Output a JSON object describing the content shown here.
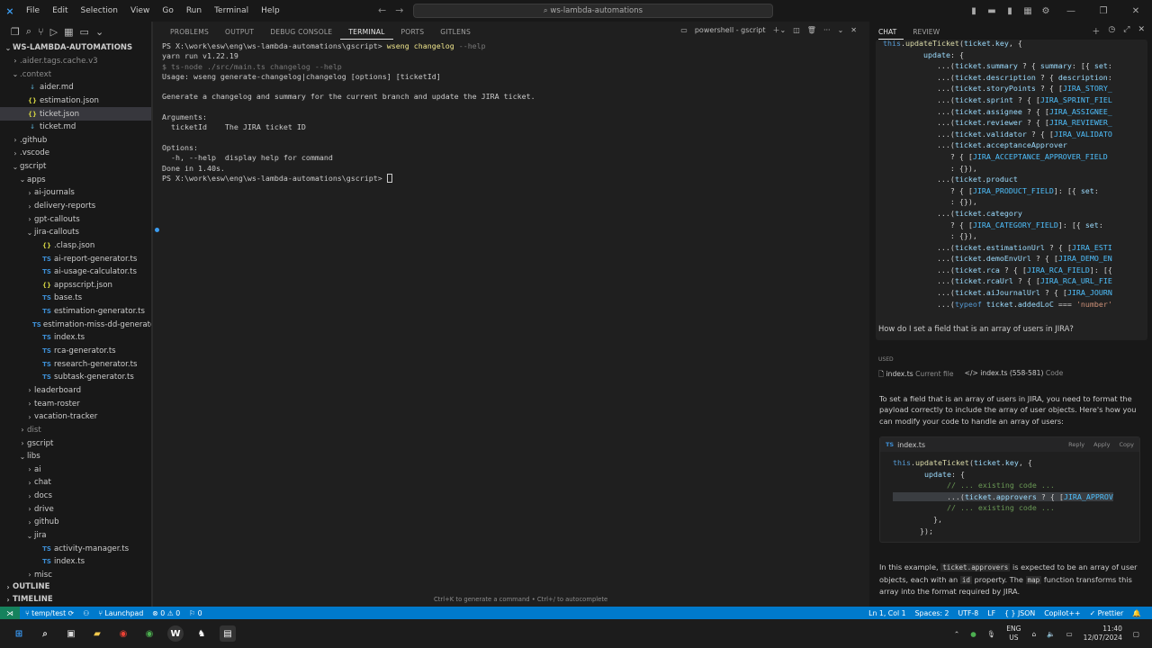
{
  "titlebar": {
    "menu": [
      "File",
      "Edit",
      "Selection",
      "View",
      "Go",
      "Run",
      "Terminal",
      "Help"
    ],
    "search": "ws-lambda-automations"
  },
  "explorer": {
    "root": "WS-LAMBDA-AUTOMATIONS",
    "items": [
      {
        "label": ".aider.tags.cache.v3",
        "depth": 1,
        "kind": "folder",
        "open": false,
        "dim": true
      },
      {
        "label": ".context",
        "depth": 1,
        "kind": "folder",
        "open": true,
        "dim": true
      },
      {
        "label": "aider.md",
        "depth": 2,
        "kind": "md"
      },
      {
        "label": "estimation.json",
        "depth": 2,
        "kind": "json"
      },
      {
        "label": "ticket.json",
        "depth": 2,
        "kind": "json",
        "selected": true
      },
      {
        "label": "ticket.md",
        "depth": 2,
        "kind": "md"
      },
      {
        "label": ".github",
        "depth": 1,
        "kind": "folder",
        "open": false
      },
      {
        "label": ".vscode",
        "depth": 1,
        "kind": "folder",
        "open": false
      },
      {
        "label": "gscript",
        "depth": 1,
        "kind": "folder",
        "open": true
      },
      {
        "label": "apps",
        "depth": 2,
        "kind": "folder",
        "open": true
      },
      {
        "label": "ai-journals",
        "depth": 3,
        "kind": "folder",
        "open": false
      },
      {
        "label": "delivery-reports",
        "depth": 3,
        "kind": "folder",
        "open": false
      },
      {
        "label": "gpt-callouts",
        "depth": 3,
        "kind": "folder",
        "open": false
      },
      {
        "label": "jira-callouts",
        "depth": 3,
        "kind": "folder",
        "open": true
      },
      {
        "label": ".clasp.json",
        "depth": 4,
        "kind": "json"
      },
      {
        "label": "ai-report-generator.ts",
        "depth": 4,
        "kind": "ts"
      },
      {
        "label": "ai-usage-calculator.ts",
        "depth": 4,
        "kind": "ts"
      },
      {
        "label": "appsscript.json",
        "depth": 4,
        "kind": "json"
      },
      {
        "label": "base.ts",
        "depth": 4,
        "kind": "ts"
      },
      {
        "label": "estimation-generator.ts",
        "depth": 4,
        "kind": "ts"
      },
      {
        "label": "estimation-miss-dd-generator.ts",
        "depth": 4,
        "kind": "ts"
      },
      {
        "label": "index.ts",
        "depth": 4,
        "kind": "ts"
      },
      {
        "label": "rca-generator.ts",
        "depth": 4,
        "kind": "ts"
      },
      {
        "label": "research-generator.ts",
        "depth": 4,
        "kind": "ts"
      },
      {
        "label": "subtask-generator.ts",
        "depth": 4,
        "kind": "ts"
      },
      {
        "label": "leaderboard",
        "depth": 3,
        "kind": "folder",
        "open": false
      },
      {
        "label": "team-roster",
        "depth": 3,
        "kind": "folder",
        "open": false
      },
      {
        "label": "vacation-tracker",
        "depth": 3,
        "kind": "folder",
        "open": false
      },
      {
        "label": "dist",
        "depth": 2,
        "kind": "folder",
        "open": false,
        "dim": true
      },
      {
        "label": "gscript",
        "depth": 2,
        "kind": "folder",
        "open": false
      },
      {
        "label": "libs",
        "depth": 2,
        "kind": "folder",
        "open": true
      },
      {
        "label": "ai",
        "depth": 3,
        "kind": "folder",
        "open": false
      },
      {
        "label": "chat",
        "depth": 3,
        "kind": "folder",
        "open": false
      },
      {
        "label": "docs",
        "depth": 3,
        "kind": "folder",
        "open": false
      },
      {
        "label": "drive",
        "depth": 3,
        "kind": "folder",
        "open": false
      },
      {
        "label": "github",
        "depth": 3,
        "kind": "folder",
        "open": false
      },
      {
        "label": "jira",
        "depth": 3,
        "kind": "folder",
        "open": true
      },
      {
        "label": "activity-manager.ts",
        "depth": 4,
        "kind": "ts"
      },
      {
        "label": "index.ts",
        "depth": 4,
        "kind": "ts"
      },
      {
        "label": "misc",
        "depth": 3,
        "kind": "folder",
        "open": false
      }
    ],
    "outline": "OUTLINE",
    "timeline": "TIMELINE"
  },
  "panel": {
    "tabs": [
      "PROBLEMS",
      "OUTPUT",
      "DEBUG CONSOLE",
      "TERMINAL",
      "PORTS",
      "GITLENS"
    ],
    "active_tab": "TERMINAL",
    "shell_label": "powershell - gscript",
    "terminal": {
      "prompt1": "PS X:\\work\\esw\\eng\\ws-lambda-automations\\gscript> ",
      "cmd1": "wseng changelog",
      "cmd1_flag": " --help",
      "line2": "yarn run v1.22.19",
      "line3": "$ ts-node ./src/main.ts changelog --help",
      "line4": "Usage: wseng generate-changelog|changelog [options] [ticketId]",
      "line5": "",
      "line6": "Generate a changelog and summary for the current branch and update the JIRA ticket.",
      "line7": "",
      "line8": "Arguments:",
      "line9": "  ticketId    The JIRA ticket ID",
      "line10": "",
      "line11": "Options:",
      "line12": "  -h, --help  display help for command",
      "line13": "Done in 1.40s.",
      "prompt2": "PS X:\\work\\esw\\eng\\ws-lambda-automations\\gscript> "
    },
    "hint": "Ctrl+K to generate a command • Ctrl+/ to autocomplete"
  },
  "chat": {
    "tabs": [
      "CHAT",
      "REVIEW"
    ],
    "active_tab": "CHAT",
    "question": "How do I set a field that is an array of users in JIRA?",
    "used_label": "USED",
    "ref1": "index.ts",
    "ref1_sub": "Current file",
    "ref2": "index.ts (558-581)",
    "ref2_sub": "Code",
    "answer_intro": "To set a field that is an array of users in JIRA, you need to format the payload correctly to include the array of user objects. Here's how you can modify your code to handle an array of users:",
    "snippet_file": "index.ts",
    "snippet_actions": [
      "Reply",
      "Apply",
      "Copy"
    ],
    "answer_outro_1": "In this example, ",
    "answer_outro_code1": "ticket.approvers",
    "answer_outro_2": " is expected to be an array of user objects, each with an ",
    "answer_outro_code2": "id",
    "answer_outro_3": " property. The ",
    "answer_outro_code3": "map",
    "answer_outro_4": " function transforms this array into the format required by JIRA."
  },
  "statusbar": {
    "branch": "temp/test",
    "launchpad": "Launchpad",
    "problems": "⊗ 0 ⚠ 0",
    "ports": "0",
    "position": "Ln 1, Col 1",
    "spaces": "Spaces: 2",
    "encoding": "UTF-8",
    "eol": "LF",
    "language": "{ } JSON",
    "copilot": "Copilot++",
    "prettier": "✓ Prettier"
  },
  "taskbar": {
    "lang1": "ENG",
    "lang2": "US",
    "time": "11:40",
    "date": "12/07/2024"
  },
  "colors": {
    "status_bar": "#007acc",
    "remote": "#16825d",
    "editor_bg": "#1f1f1f",
    "sidebar_bg": "#181818"
  }
}
